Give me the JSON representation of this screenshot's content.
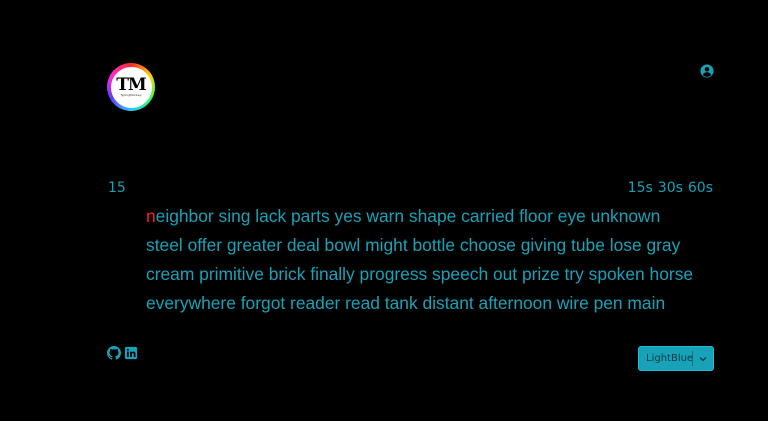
{
  "logo": {
    "mark": "TM",
    "subtitle": "TypingMonkey"
  },
  "header": {
    "user_icon": "user-circle-icon"
  },
  "test": {
    "counter": "15",
    "time_options": [
      "15s",
      "30s",
      "60s"
    ],
    "current_char": "n",
    "line1_rest": "eighbor sing lack parts yes warn shape carried floor eye unknown",
    "line2": "steel offer greater deal bowl might bottle choose giving tube lose gray",
    "line3": "cream primitive brick finally progress speech out prize try spoken horse",
    "line4": "everywhere forgot reader read tank distant afternoon wire pen main"
  },
  "footer": {
    "icons": [
      "github-icon",
      "linkedin-icon"
    ],
    "theme_label": "LightBlue",
    "theme_caret_icon": "chevron-down-icon"
  },
  "colors": {
    "background": "#000000",
    "accent": "#17a2b8",
    "current_char": "#ff1a1a"
  }
}
